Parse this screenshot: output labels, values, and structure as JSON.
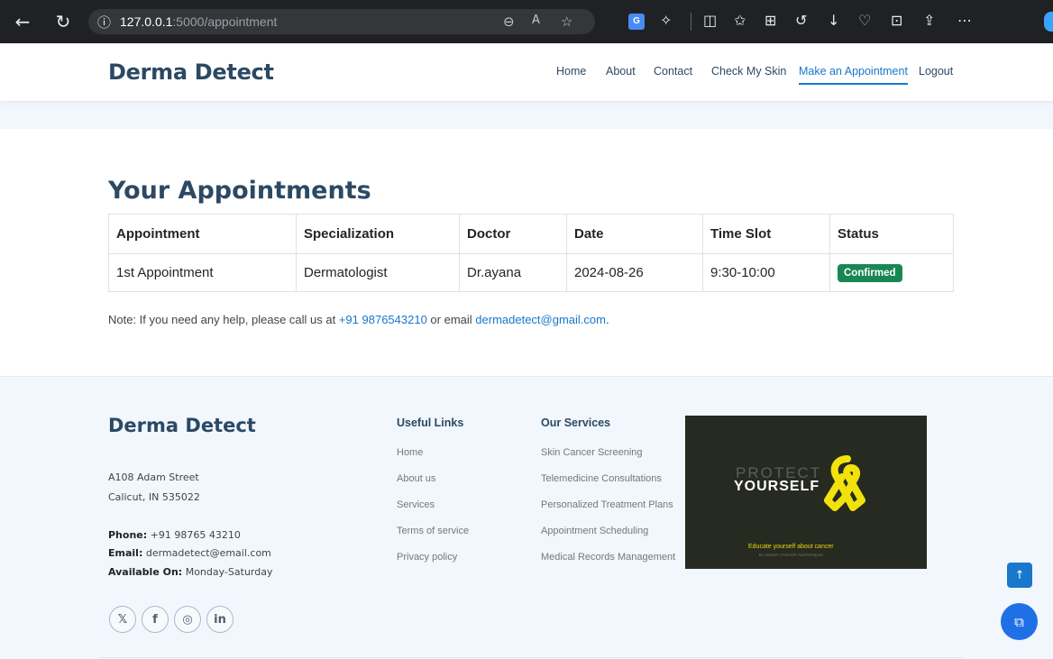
{
  "browser": {
    "url_host": "127.0.0.1",
    "url_path": ":5000/appointment"
  },
  "header": {
    "brand": "Derma Detect",
    "nav": [
      "Home",
      "About",
      "Contact",
      "Check My Skin",
      "Make an Appointment",
      "Logout"
    ],
    "active_nav": "Make an Appointment"
  },
  "main": {
    "title": "Your Appointments",
    "table": {
      "columns": [
        "Appointment",
        "Specialization",
        "Doctor",
        "Date",
        "Time Slot",
        "Status"
      ],
      "rows": [
        {
          "appointment": "1st Appointment",
          "specialization": "Dermatologist",
          "doctor": "Dr.ayana",
          "date": "2024-08-26",
          "time_slot": "9:30-10:00",
          "status": "Confirmed"
        }
      ]
    },
    "note": {
      "prefix": "Note: If you need any help, please call us at ",
      "phone": "+91 9876543210",
      "middle": " or email ",
      "email": "dermadetect@gmail.com",
      "suffix": "."
    }
  },
  "footer": {
    "brand": "Derma Detect",
    "address1": "A108 Adam Street",
    "address2": "Calicut, IN 535022",
    "phone_label": "Phone:",
    "phone": "+91 98765 43210",
    "email_label": "Email:",
    "email": "dermadetect@email.com",
    "available_label": "Available On:",
    "available": "Monday-Saturday",
    "useful_links_title": "Useful Links",
    "useful_links": [
      "Home",
      "About us",
      "Services",
      "Terms of service",
      "Privacy policy"
    ],
    "services_title": "Our Services",
    "services": [
      "Skin Cancer Screening",
      "Telemedicine Consultations",
      "Personalized Treatment Plans",
      "Appointment Scheduling",
      "Medical Records Management"
    ],
    "promo": {
      "line1": "PROTECT",
      "line2": "YOURSELF",
      "line3": "Educate yourself about cancer",
      "line4": "BLADDER CANCER AWARENESS",
      "ribbon_color": "#f2e20c"
    },
    "social": [
      "x-icon",
      "facebook-icon",
      "instagram-icon",
      "linkedin-icon"
    ]
  },
  "colors": {
    "brand": "#2c4964",
    "accent": "#1977cc",
    "status_confirmed": "#198754"
  }
}
